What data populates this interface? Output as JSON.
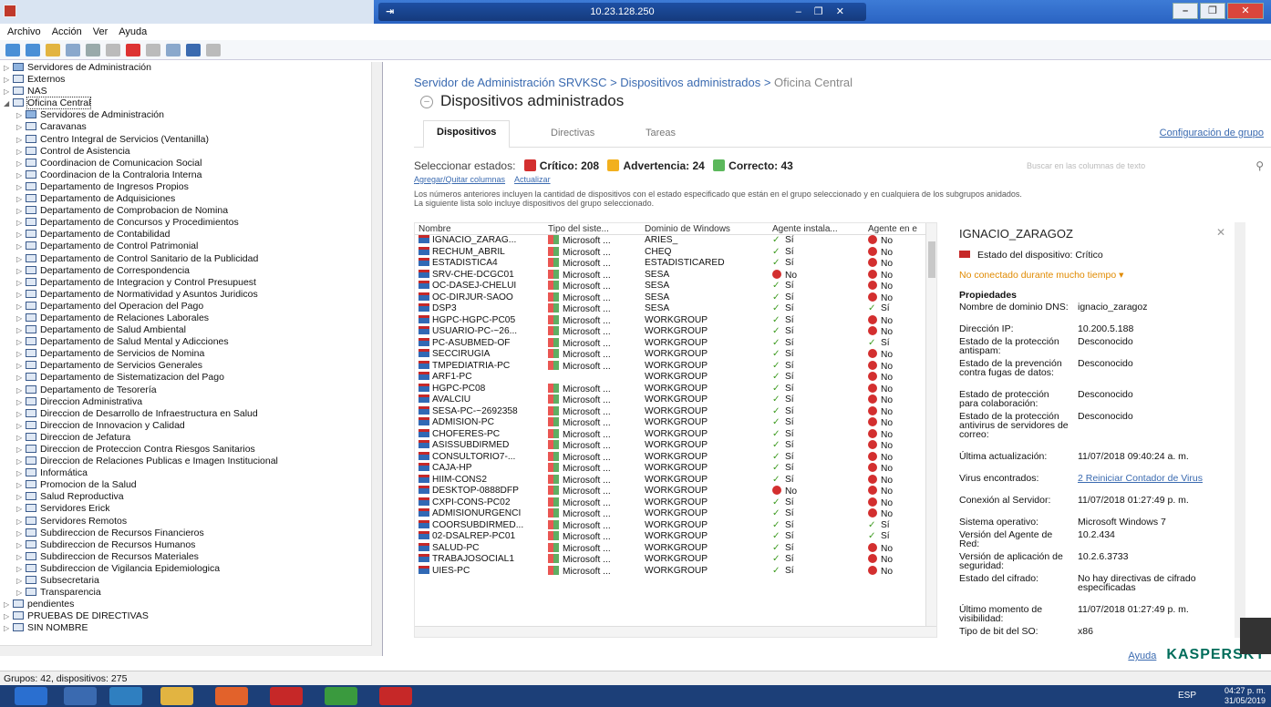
{
  "window": {
    "host": "10.23.128.250"
  },
  "menu": [
    "Archivo",
    "Acción",
    "Ver",
    "Ayuda"
  ],
  "tree": [
    {
      "label": "Servidores de Administración",
      "indent": 1,
      "type": "srv"
    },
    {
      "label": "Externos",
      "indent": 1
    },
    {
      "label": "NAS",
      "indent": 1
    },
    {
      "label": "Oficina Central",
      "indent": 1,
      "open": true,
      "selected": true
    },
    {
      "label": "Servidores de Administración",
      "indent": 2,
      "type": "srv"
    },
    {
      "label": "Caravanas",
      "indent": 2
    },
    {
      "label": "Centro Integral de Servicios (Ventanilla)",
      "indent": 2
    },
    {
      "label": "Control de Asistencia",
      "indent": 2
    },
    {
      "label": "Coordinacion de Comunicacion Social",
      "indent": 2
    },
    {
      "label": "Coordinacion de la Contraloria Interna",
      "indent": 2
    },
    {
      "label": "Departamento de Ingresos Propios",
      "indent": 2
    },
    {
      "label": "Departamento de Adquisiciones",
      "indent": 2
    },
    {
      "label": "Departamento de Comprobacion de Nomina",
      "indent": 2
    },
    {
      "label": "Departamento de Concursos y Procedimientos",
      "indent": 2
    },
    {
      "label": "Departamento de Contabilidad",
      "indent": 2
    },
    {
      "label": "Departamento de Control Patrimonial",
      "indent": 2
    },
    {
      "label": "Departamento de Control Sanitario de la Publicidad",
      "indent": 2
    },
    {
      "label": "Departamento de Correspondencia",
      "indent": 2
    },
    {
      "label": "Departamento de Integracion y Control Presupuest",
      "indent": 2
    },
    {
      "label": "Departamento de Normatividad y Asuntos Juridicos",
      "indent": 2
    },
    {
      "label": "Departamento del Operacion del Pago",
      "indent": 2
    },
    {
      "label": "Departamento de Relaciones Laborales",
      "indent": 2
    },
    {
      "label": "Departamento de Salud Ambiental",
      "indent": 2
    },
    {
      "label": "Departamento de Salud Mental y Adicciones",
      "indent": 2
    },
    {
      "label": "Departamento de Servicios de Nomina",
      "indent": 2
    },
    {
      "label": "Departamento de Servicios Generales",
      "indent": 2
    },
    {
      "label": "Departamento de Sistematizacion del Pago",
      "indent": 2
    },
    {
      "label": "Departamento de Tesorería",
      "indent": 2
    },
    {
      "label": "Direccion Administrativa",
      "indent": 2
    },
    {
      "label": "Direccion de Desarrollo de Infraestructura en Salud",
      "indent": 2
    },
    {
      "label": "Direccion de Innovacion y Calidad",
      "indent": 2
    },
    {
      "label": "Direccion de Jefatura",
      "indent": 2
    },
    {
      "label": "Direccion de Proteccion Contra Riesgos Sanitarios",
      "indent": 2
    },
    {
      "label": "Direccion de Relaciones Publicas e Imagen Institucional",
      "indent": 2
    },
    {
      "label": "Informática",
      "indent": 2
    },
    {
      "label": "Promocion de la Salud",
      "indent": 2
    },
    {
      "label": "Salud Reproductiva",
      "indent": 2
    },
    {
      "label": "Servidores Erick",
      "indent": 2
    },
    {
      "label": "Servidores Remotos",
      "indent": 2
    },
    {
      "label": "Subdireccion de Recursos Financieros",
      "indent": 2
    },
    {
      "label": "Subdireccion de Recursos Humanos",
      "indent": 2
    },
    {
      "label": "Subdireccion de Recursos Materiales",
      "indent": 2
    },
    {
      "label": "Subdireccion de Vigilancia Epidemiologica",
      "indent": 2
    },
    {
      "label": "Subsecretaria",
      "indent": 2
    },
    {
      "label": "Transparencia",
      "indent": 2
    },
    {
      "label": "pendientes",
      "indent": 1
    },
    {
      "label": "PRUEBAS DE DIRECTIVAS",
      "indent": 1
    },
    {
      "label": "SIN NOMBRE",
      "indent": 1
    }
  ],
  "status_bar": "Grupos: 42, dispositivos: 275",
  "breadcrumb": {
    "a": "Servidor de Administración SRVKSC",
    "sep1": " > ",
    "b": "Dispositivos administrados",
    "sep2": " > ",
    "c": "Oficina Central"
  },
  "page_title": "Dispositivos administrados",
  "tabs": [
    "Dispositivos",
    "Directivas",
    "Tareas"
  ],
  "config_link": "Configuración de grupo",
  "states": {
    "label": "Seleccionar estados:",
    "critical": "Crítico: 208",
    "warning": "Advertencia: 24",
    "ok": "Correcto: 43",
    "critical_color": "#d32f2f",
    "warning_color": "#f2b01e",
    "ok_color": "#5cb85c"
  },
  "search_placeholder": "Buscar en las columnas de texto",
  "links": [
    "Agregar/Quitar columnas",
    "Actualizar"
  ],
  "note": [
    "Los números anteriores incluyen la cantidad de dispositivos con el estado especificado que están en el grupo seleccionado y en cualquiera de los subgrupos anidados.",
    "La siguiente lista solo incluye dispositivos del grupo seleccionado."
  ],
  "columns": [
    "Nombre",
    "Tipo del siste...",
    "Dominio de Windows",
    "Agente instala...",
    "Agente en e"
  ],
  "devices": [
    [
      "IGNACIO_ZARAG...",
      "Microsoft ...",
      "ARIES_",
      "Sí",
      "No"
    ],
    [
      "RECHUM_ABRIL",
      "Microsoft ...",
      "CHEQ",
      "Sí",
      "No"
    ],
    [
      "ESTADISTICA4",
      "Microsoft ...",
      "ESTADISTICARED",
      "Sí",
      "No"
    ],
    [
      "SRV-CHE-DCGC01",
      "Microsoft ...",
      "SESA",
      "No",
      "No"
    ],
    [
      "OC-DASEJ-CHELUI",
      "Microsoft ...",
      "SESA",
      "Sí",
      "No"
    ],
    [
      "OC-DIRJUR-SAOO",
      "Microsoft ...",
      "SESA",
      "Sí",
      "No"
    ],
    [
      "DSP3",
      "Microsoft ...",
      "SESA",
      "Sí",
      "Sí"
    ],
    [
      "HGPC-HGPC-PC05",
      "Microsoft ...",
      "WORKGROUP",
      "Sí",
      "No"
    ],
    [
      "USUARIO-PC-~26...",
      "Microsoft ...",
      "WORKGROUP",
      "Sí",
      "No"
    ],
    [
      "PC-ASUBMED-OF",
      "Microsoft ...",
      "WORKGROUP",
      "Sí",
      "Sí"
    ],
    [
      "SECCIRUGIA",
      "Microsoft ...",
      "WORKGROUP",
      "Sí",
      "No"
    ],
    [
      "TMPEDIATRIA-PC",
      "Microsoft ...",
      "WORKGROUP",
      "Sí",
      "No"
    ],
    [
      "ARF1-PC",
      "",
      "WORKGROUP",
      "Sí",
      "No"
    ],
    [
      "HGPC-PC08",
      "Microsoft ...",
      "WORKGROUP",
      "Sí",
      "No"
    ],
    [
      "AVALCIU",
      "Microsoft ...",
      "WORKGROUP",
      "Sí",
      "No"
    ],
    [
      "SESA-PC-~2692358",
      "Microsoft ...",
      "WORKGROUP",
      "Sí",
      "No"
    ],
    [
      "ADMISION-PC",
      "Microsoft ...",
      "WORKGROUP",
      "Sí",
      "No"
    ],
    [
      "CHOFERES-PC",
      "Microsoft ...",
      "WORKGROUP",
      "Sí",
      "No"
    ],
    [
      "ASISSUBDIRMED",
      "Microsoft ...",
      "WORKGROUP",
      "Sí",
      "No"
    ],
    [
      "CONSULTORIO7-...",
      "Microsoft ...",
      "WORKGROUP",
      "Sí",
      "No"
    ],
    [
      "CAJA-HP",
      "Microsoft ...",
      "WORKGROUP",
      "Sí",
      "No"
    ],
    [
      "HIIM-CONS2",
      "Microsoft ...",
      "WORKGROUP",
      "Sí",
      "No"
    ],
    [
      "DESKTOP-0888DFP",
      "Microsoft ...",
      "WORKGROUP",
      "No",
      "No"
    ],
    [
      "CXPI-CONS-PC02",
      "Microsoft ...",
      "WORKGROUP",
      "Sí",
      "No"
    ],
    [
      "ADMISIONURGENCI",
      "Microsoft ...",
      "WORKGROUP",
      "Sí",
      "No"
    ],
    [
      "COORSUBDIRMED...",
      "Microsoft ...",
      "WORKGROUP",
      "Sí",
      "Sí"
    ],
    [
      "02-DSALREP-PC01",
      "Microsoft ...",
      "WORKGROUP",
      "Sí",
      "Sí"
    ],
    [
      "SALUD-PC",
      "Microsoft ...",
      "WORKGROUP",
      "Sí",
      "No"
    ],
    [
      "TRABAJOSOCIAL1",
      "Microsoft ...",
      "WORKGROUP",
      "Sí",
      "No"
    ],
    [
      "UIES-PC",
      "Microsoft ...",
      "WORKGROUP",
      "Sí",
      "No"
    ]
  ],
  "details": {
    "name": "IGNACIO_ZARAGOZ",
    "status": "Estado del dispositivo: Crítico",
    "warning": "No conectado durante mucho tiempo",
    "props_title": "Propiedades",
    "props": [
      {
        "k": "Nombre de dominio DNS:",
        "v": "ignacio_zaragoz",
        "h": 2
      },
      {
        "k": "Dirección IP:",
        "v": "10.200.5.188",
        "h": 1
      },
      {
        "k": "Estado de la protección antispam:",
        "v": "Desconocido",
        "h": 2
      },
      {
        "k": "Estado de la prevención contra fugas de datos:",
        "v": "Desconocido",
        "h": 3
      },
      {
        "k": "Estado de protección para colaboración:",
        "v": "Desconocido",
        "h": 2
      },
      {
        "k": "Estado de la protección antivirus de servidores de correo:",
        "v": "Desconocido",
        "h": 4
      },
      {
        "k": "Última actualización:",
        "v": "11/07/2018 09:40:24 a. m.",
        "h": 2
      },
      {
        "k": "Virus encontrados:",
        "v": "2 Reiniciar Contador de Virus",
        "h": 2,
        "link": true
      },
      {
        "k": "Conexión al Servidor:",
        "v": "11/07/2018 01:27:49 p. m.",
        "h": 2
      },
      {
        "k": "Sistema operativo:",
        "v": "Microsoft Windows 7",
        "h": 1
      },
      {
        "k": "Versión del Agente de Red:",
        "v": "10.2.434",
        "h": 2
      },
      {
        "k": "Versión de aplicación de seguridad:",
        "v": "10.2.6.3733",
        "h": 2
      },
      {
        "k": "Estado del cifrado:",
        "v": "No hay directivas de cifrado especificadas",
        "h": 3
      },
      {
        "k": "Último momento de visibilidad:",
        "v": "11/07/2018 01:27:49 p. m.",
        "h": 2
      },
      {
        "k": "Tipo de bit del SO:",
        "v": "x86",
        "h": 1
      }
    ]
  },
  "footer": {
    "help": "Ayuda",
    "logo": "KASPERSKY"
  },
  "taskbar": {
    "lang": "ESP",
    "time": "04:27 p. m.",
    "date": "31/05/2019"
  }
}
